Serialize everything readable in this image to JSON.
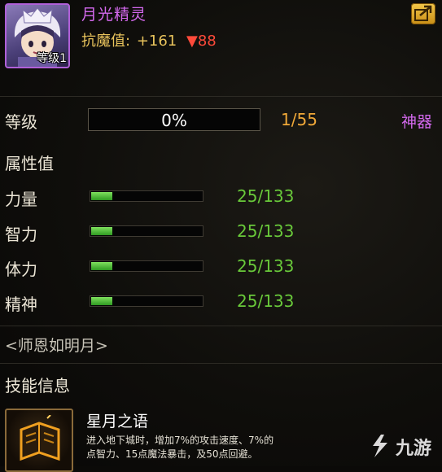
{
  "header": {
    "character_name": "月光精灵",
    "avatar_level": "等级1",
    "resist_label": "抗魔值:",
    "resist_plus": "+161",
    "resist_minus": "▼88",
    "export_icon": "export-arrow-icon"
  },
  "level": {
    "label": "等级",
    "progress_text": "0%",
    "progress_fraction": 0,
    "count": "1/55",
    "artifact_link": "神器"
  },
  "attributes": {
    "title": "属性值",
    "items": [
      {
        "label": "力量",
        "value": "25/133",
        "fraction": 0.188
      },
      {
        "label": "智力",
        "value": "25/133",
        "fraction": 0.188
      },
      {
        "label": "体力",
        "value": "25/133",
        "fraction": 0.188
      },
      {
        "label": "精神",
        "value": "25/133",
        "fraction": 0.188
      }
    ]
  },
  "motto": "<师恩如明月>",
  "skills": {
    "title": "技能信息",
    "items": [
      {
        "name": "星月之语",
        "desc_line1": "进入地下城时，增加7%的攻击速度、7%的",
        "desc_line2": "点智力、15点魔法暴击，及50点回避。",
        "icon": "spellbook-icon"
      }
    ]
  },
  "watermark": {
    "text": "九游",
    "icon": "jiuyou-logo-icon"
  },
  "colors": {
    "name_purple": "#d469ee",
    "gold": "#e8c35c",
    "red": "#ff4a3a",
    "orange": "#f0a838",
    "green": "#69c93a"
  }
}
